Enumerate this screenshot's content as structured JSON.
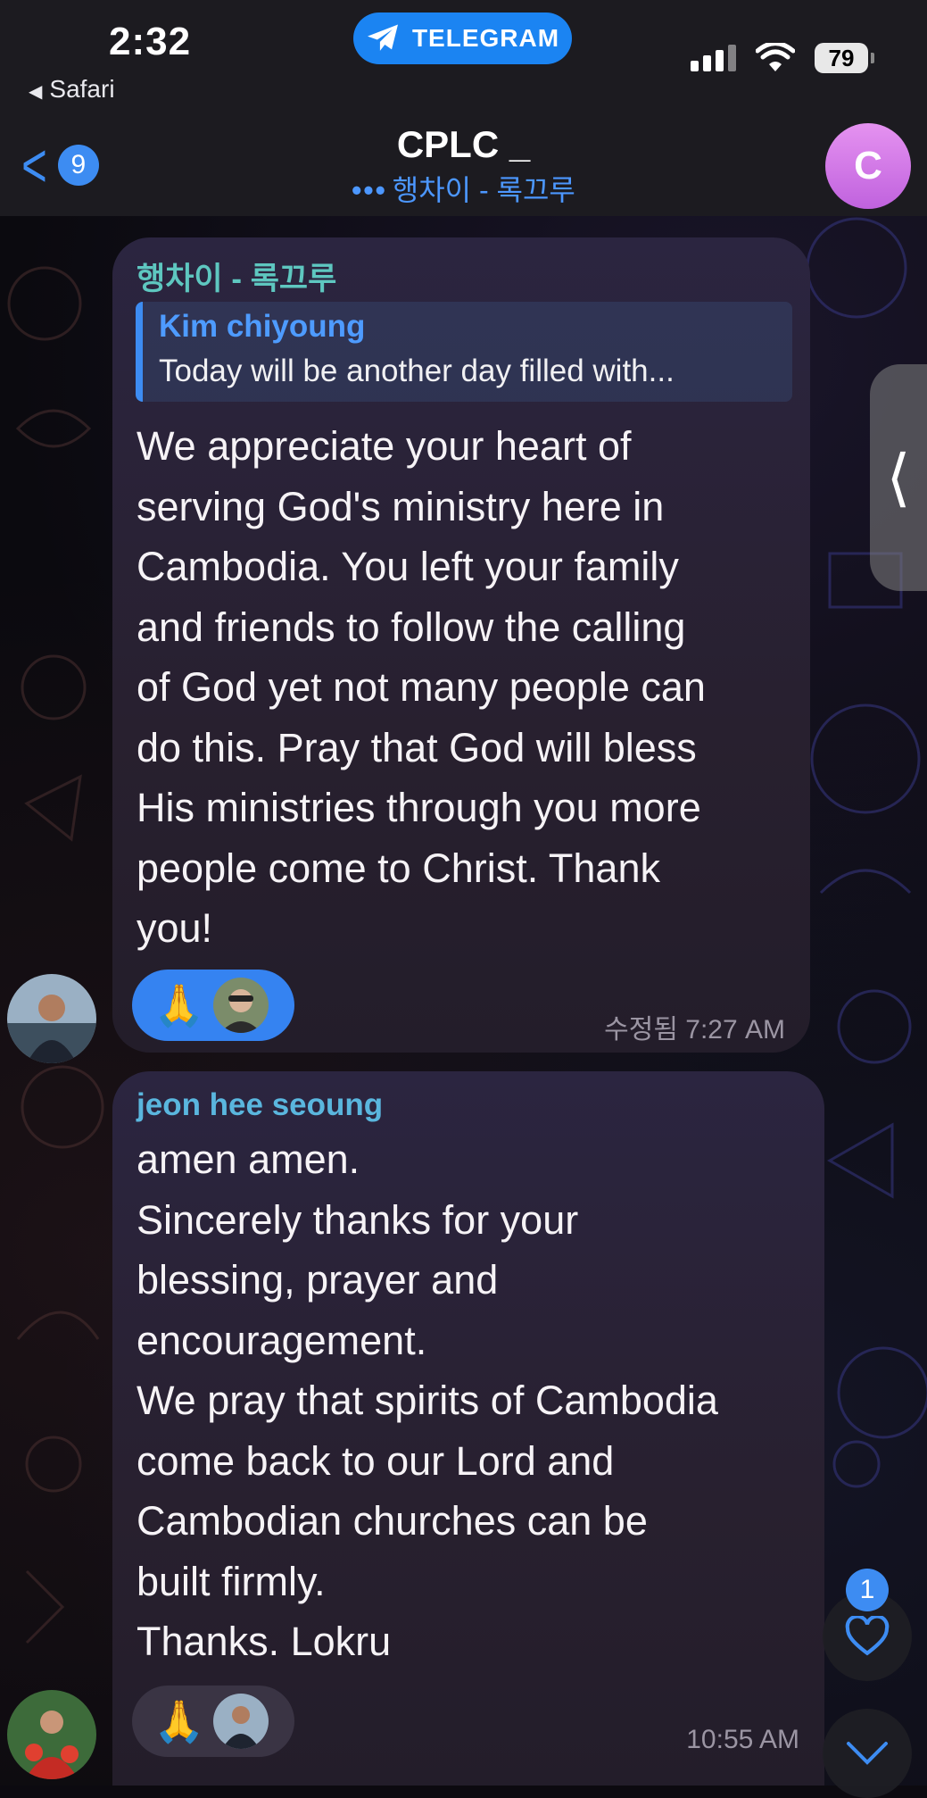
{
  "status_bar": {
    "time": "2:32",
    "back_app": "Safari",
    "app_pill": "TELEGRAM",
    "battery": "79"
  },
  "header": {
    "unread_count": "9",
    "title": "CPLC _",
    "typing_dots": "•••",
    "subtitle": "행차이 - 록끄루",
    "avatar_letter": "C"
  },
  "messages": [
    {
      "sender": "행차이 - 록끄루",
      "reply_to": {
        "name": "Kim chiyoung",
        "text": "Today will be another day filled with..."
      },
      "text": "We appreciate your heart of\nserving God's ministry here in\nCambodia. You left your family\nand friends to follow the calling\nof God yet not many people can\ndo this. Pray that God will bless\nHis ministries through you more\npeople come to Christ. Thank\nyou!",
      "reaction": "🙏",
      "timestamp": "수정됨 7:27 AM"
    },
    {
      "sender": "jeon hee seoung",
      "text": "amen amen.\nSincerely thanks for your\nblessing, prayer and\nencouragement.\nWe pray that spirits of Cambodia\ncome back to our Lord and\nCambodian churches can be\nbuilt firmly.\nThanks. Lokru",
      "reaction": "🙏",
      "timestamp": "10:55 AM"
    }
  ],
  "floating": {
    "reaction_count": "1"
  },
  "colors": {
    "accent": "#3d8cf2",
    "bubble": "#2a2334",
    "sender_1": "#5ec7c0",
    "sender_2": "#5ab6de"
  }
}
